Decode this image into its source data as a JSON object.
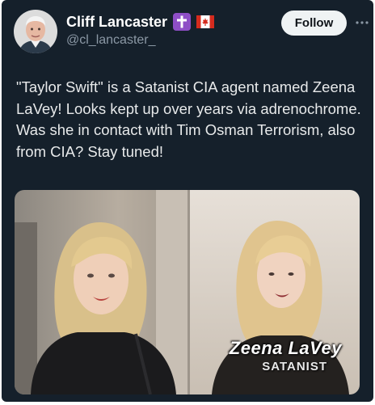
{
  "tweet": {
    "display_name": "Cliff Lancaster",
    "handle": "@cl_lancaster_",
    "follow_label": "Follow",
    "text": "\"Taylor Swift\" is a Satanist CIA agent named Zeena LaVey! Looks kept up over years via adrenochrome. Was she in contact with Tim Osman Terrorism, also from CIA? Stay tuned!",
    "badges": [
      "latin-cross-icon",
      "canada-flag-icon"
    ],
    "more_icon": "more-dots-icon"
  },
  "media": {
    "caption_name": "Zeena LaVey",
    "caption_subtitle": "SATANIST"
  },
  "colors": {
    "card_background": "#15202b",
    "text_primary": "#e7e9ea",
    "text_secondary": "#8b98a5",
    "follow_button_bg": "#eff3f4",
    "cross_badge_bg": "#8e4ec6",
    "flag_red": "#d52b1e"
  }
}
